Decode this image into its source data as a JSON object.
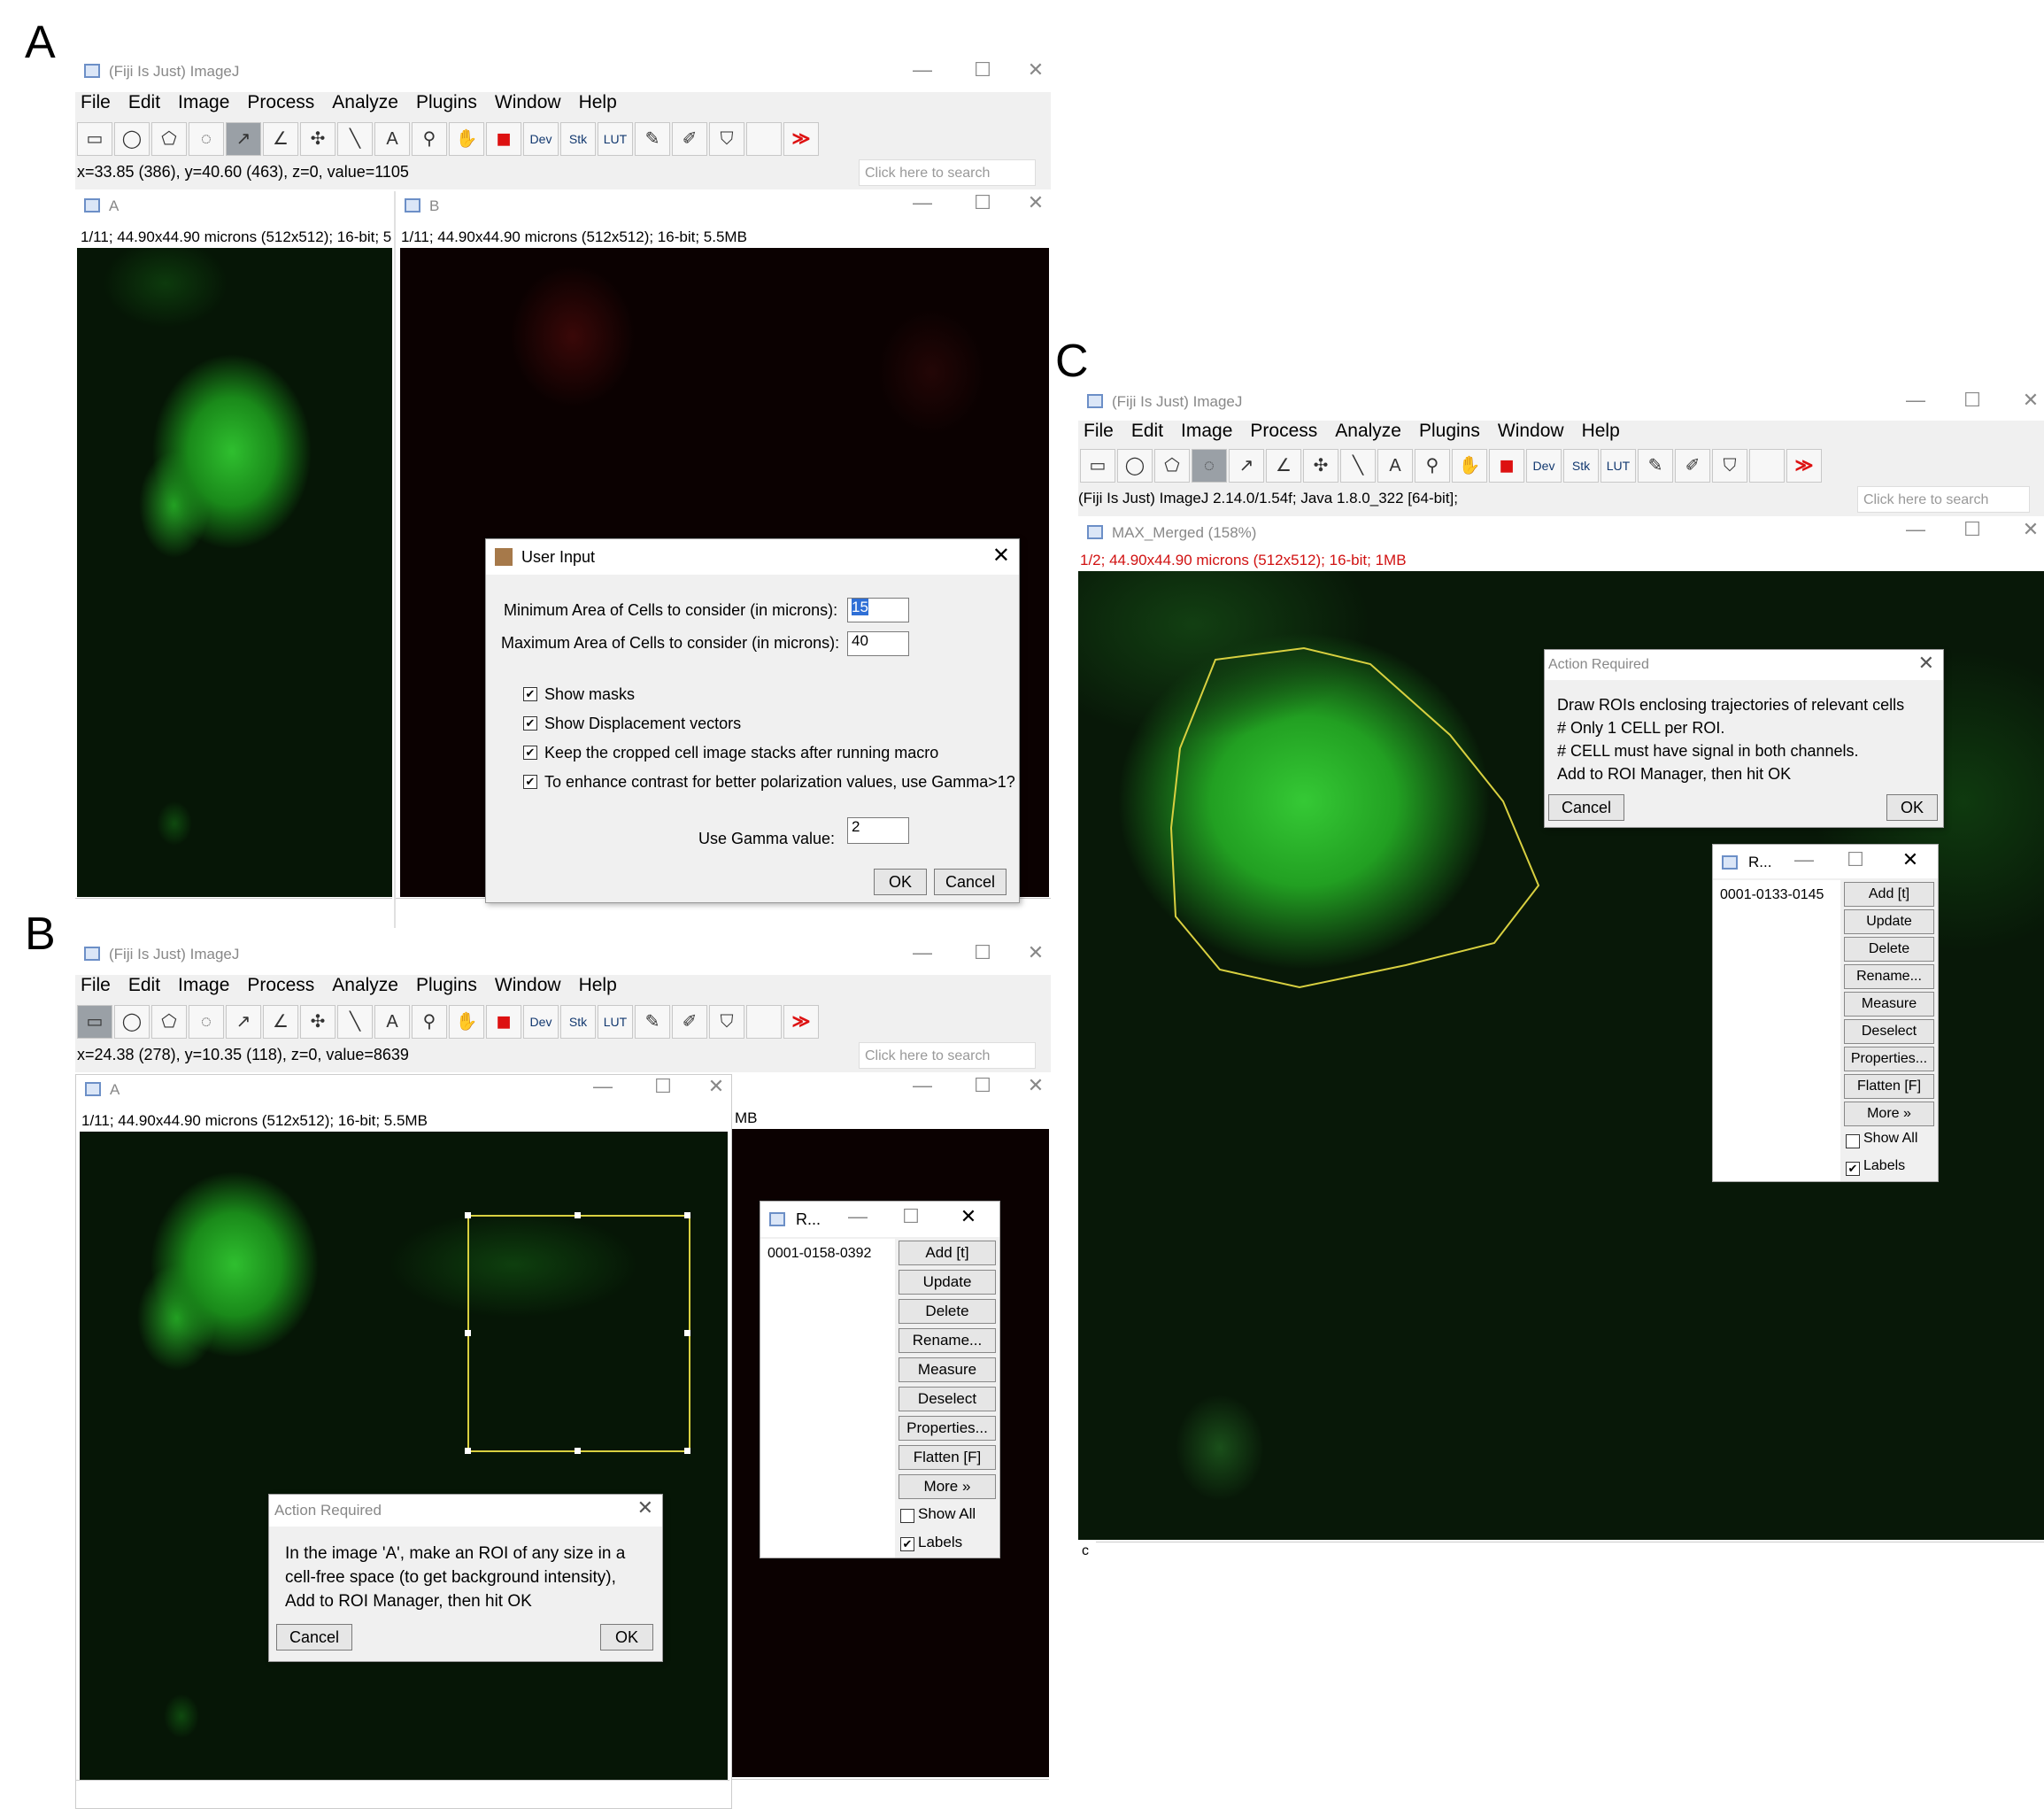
{
  "panels": {
    "a": "A",
    "b": "B",
    "c": "C"
  },
  "menu": [
    "File",
    "Edit",
    "Image",
    "Process",
    "Analyze",
    "Plugins",
    "Window",
    "Help"
  ],
  "app_title": "(Fiji Is Just) ImageJ",
  "search_placeholder": "Click here to search",
  "window_controls": {
    "min": "—",
    "max": "☐",
    "close": "✕"
  },
  "tool_text": {
    "dev": "Dev",
    "stk": "Stk",
    "lut": "LUT",
    "more": "≫"
  },
  "panel_a": {
    "status": "x=33.85 (386), y=40.60 (463), z=0, value=1105",
    "win_a_title": "A",
    "win_a_info": "1/11; 44.90x44.90 microns (512x512); 16-bit; 5",
    "win_b_title": "B",
    "win_b_info": "1/11; 44.90x44.90 microns (512x512); 16-bit; 5.5MB",
    "dialog": {
      "title": "User Input",
      "min_label": "Minimum Area of Cells to consider (in microns):",
      "min_value": "15",
      "max_label": "Maximum Area of Cells to consider (in microns):",
      "max_value": "40",
      "checks": [
        "Show masks",
        "Show Displacement vectors",
        "Keep the cropped cell image stacks after running macro",
        "To enhance contrast for better polarization values, use Gamma>1?"
      ],
      "gamma_label": "Use Gamma value:",
      "gamma_value": "2",
      "ok": "OK",
      "cancel": "Cancel"
    }
  },
  "panel_b": {
    "status": "x=24.38 (278), y=10.35 (118), z=0, value=8639",
    "win_a_title": "A",
    "win_a_info": "1/11; 44.90x44.90 microns (512x512); 16-bit; 5.5MB",
    "win_b_info_tail": "MB",
    "roi_manager": {
      "title": "R...",
      "item": "0001-0158-0392",
      "buttons": [
        "Add [t]",
        "Update",
        "Delete",
        "Rename...",
        "Measure",
        "Deselect",
        "Properties...",
        "Flatten [F]",
        "More »"
      ],
      "show_all": "Show All",
      "labels": "Labels"
    },
    "action": {
      "title": "Action Required",
      "lines": [
        "In the image 'A', make an ROI of any size in a",
        "cell-free space (to get background intensity),",
        "Add to ROI Manager, then hit OK"
      ],
      "cancel": "Cancel",
      "ok": "OK"
    }
  },
  "panel_c": {
    "status": "(Fiji Is Just) ImageJ 2.14.0/1.54f; Java 1.8.0_322 [64-bit];",
    "img_title": "MAX_Merged (158%)",
    "img_info": "1/2; 44.90x44.90 microns (512x512); 16-bit; 1MB",
    "channel_label": "c",
    "action": {
      "title": "Action Required",
      "lines": [
        "Draw ROIs enclosing trajectories of relevant cells",
        "# Only 1 CELL per ROI.",
        "# CELL must have signal in both channels.",
        "Add to ROI Manager, then hit OK"
      ],
      "cancel": "Cancel",
      "ok": "OK"
    },
    "roi_manager": {
      "title": "R...",
      "item": "0001-0133-0145",
      "buttons": [
        "Add [t]",
        "Update",
        "Delete",
        "Rename...",
        "Measure",
        "Deselect",
        "Properties...",
        "Flatten [F]",
        "More »"
      ],
      "show_all": "Show All",
      "labels": "Labels"
    }
  },
  "colors": {
    "accent_red": "#d11111",
    "roi_yellow": "#d8d040",
    "cell_green": "#33c233"
  }
}
